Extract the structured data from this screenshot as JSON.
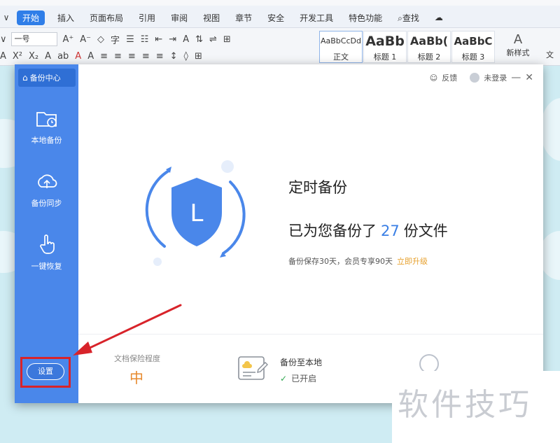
{
  "menubar": {
    "tabs": [
      "开始",
      "插入",
      "页面布局",
      "引用",
      "审阅",
      "视图",
      "章节",
      "安全",
      "开发工具",
      "特色功能",
      "查找"
    ],
    "active_tab": "开始"
  },
  "toolbar": {
    "font_size": "一号",
    "styles": [
      {
        "sample": "AaBbCcDd",
        "name": "正文"
      },
      {
        "sample": "AaBb",
        "name": "标题 1"
      },
      {
        "sample": "AaBb(",
        "name": "标题 2"
      },
      {
        "sample": "AaBbC",
        "name": "标题 3"
      }
    ],
    "new_style": "新样式",
    "cut_label": "文"
  },
  "dialog": {
    "sidebar_title": "备份中心",
    "sidebar_items": [
      "本地备份",
      "备份同步",
      "一键恢复"
    ],
    "settings_label": "设置",
    "feedback": "反馈",
    "login": "未登录",
    "shield_letter": "L",
    "title": "定时备份",
    "count_prefix": "已为您备份了",
    "count": "27",
    "count_suffix": "份文件",
    "note": "备份保存30天，会员专享90天",
    "upgrade": "立即升级",
    "level_label": "文档保险程度",
    "level_value": "中",
    "local_label": "备份至本地",
    "local_status": "已开启"
  },
  "watermark": "软件技巧",
  "colors": {
    "accent": "#4a87ea",
    "highlight": "#d8232a",
    "level": "#e7892d",
    "upgrade": "#e7a12f"
  }
}
